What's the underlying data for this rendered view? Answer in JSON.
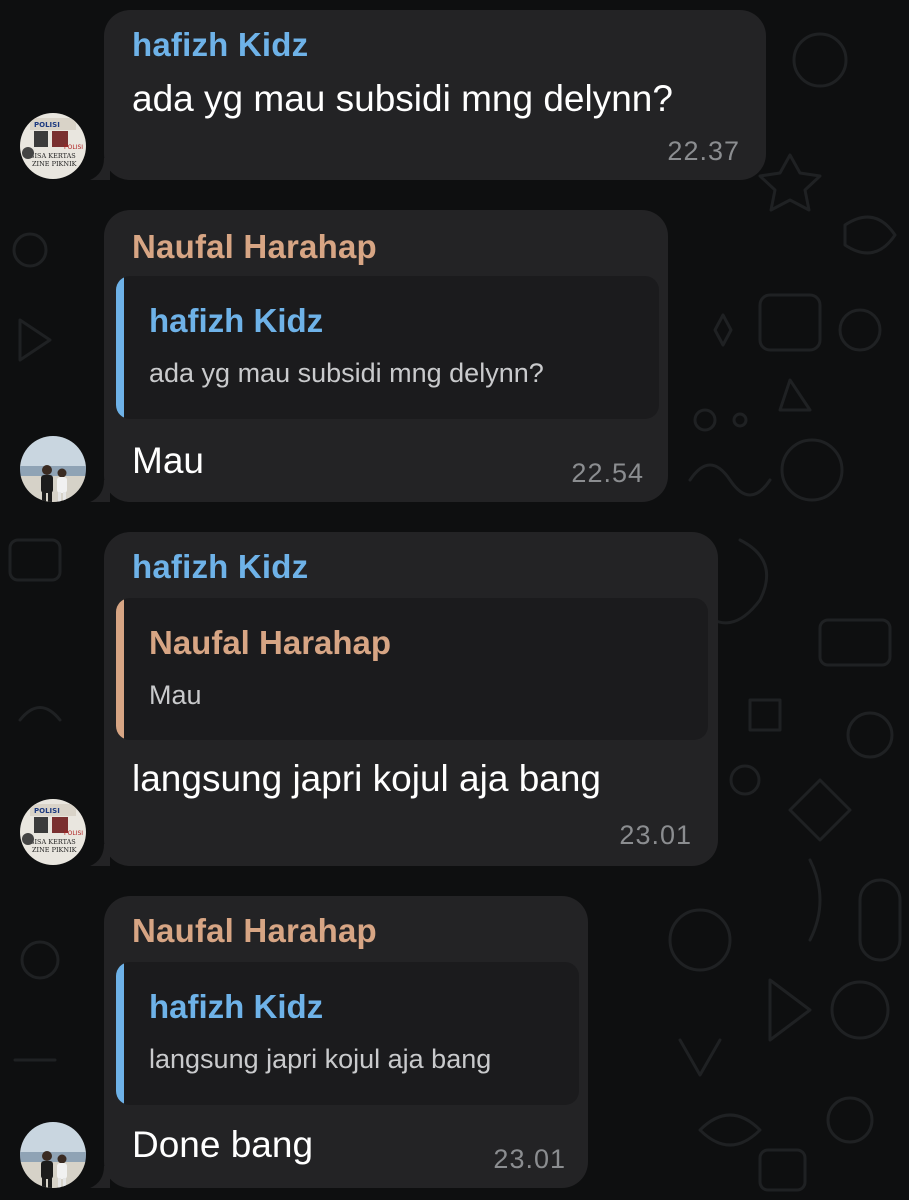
{
  "colors": {
    "background": "#0e0f10",
    "bubble": "#232325",
    "quote_background": "#1b1b1d",
    "hafizh_name": "#6eb2e8",
    "naufal_name": "#d7a584",
    "timestamp": "#8b8d90"
  },
  "messages": [
    {
      "sender": "hafizh Kidz",
      "text": "ada yg mau subsidi mng delynn?",
      "time": "22.37",
      "avatar": "avatar-hafizh"
    },
    {
      "sender": "Naufal Harahap",
      "quote": {
        "sender": "hafizh Kidz",
        "text": "ada yg mau subsidi mng delynn?"
      },
      "text": "Mau",
      "time": "22.54",
      "avatar": "avatar-naufal"
    },
    {
      "sender": "hafizh Kidz",
      "quote": {
        "sender": "Naufal Harahap",
        "text": "Mau"
      },
      "text": "langsung japri kojul aja bang",
      "time": "23.01",
      "avatar": "avatar-hafizh"
    },
    {
      "sender": "Naufal Harahap",
      "quote": {
        "sender": "hafizh Kidz",
        "text": "langsung japri kojul aja bang"
      },
      "text": "Done bang",
      "time": "23.01",
      "avatar": "avatar-naufal"
    }
  ],
  "avatar_art": {
    "hafizh": {
      "top": "POLISI",
      "middle": "POLISI",
      "line1": "SISA KERTAS",
      "line2": "ZINE PIKNIK"
    }
  }
}
